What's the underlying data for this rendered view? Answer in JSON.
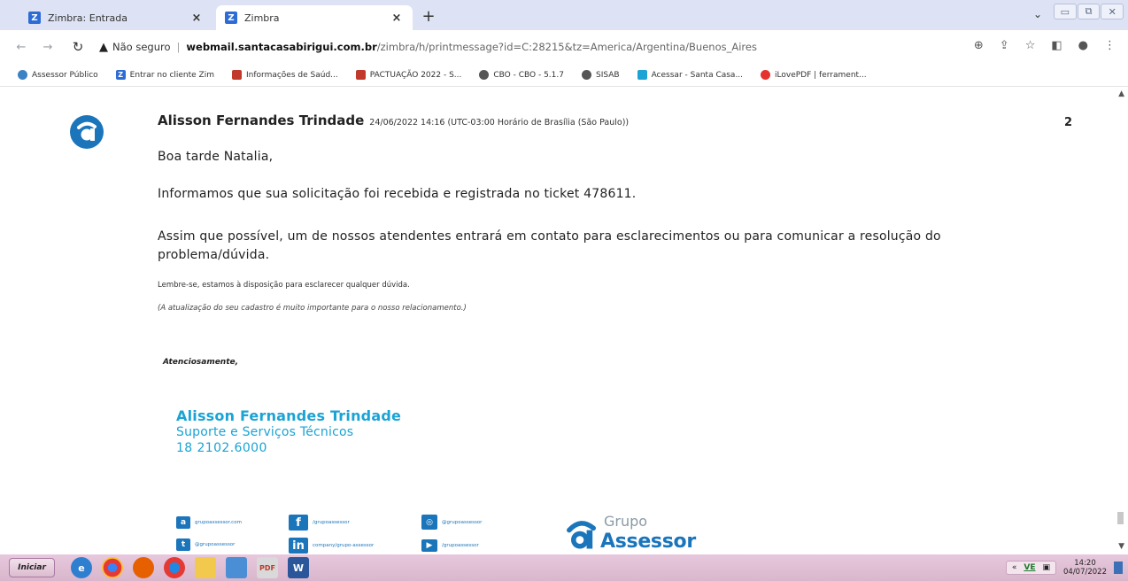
{
  "browser": {
    "tabs": [
      {
        "title": "Zimbra: Entrada",
        "favicon": "Z",
        "active": false
      },
      {
        "title": "Zimbra",
        "favicon": "Z",
        "active": true
      }
    ],
    "tab_close_glyph": "×",
    "new_tab_glyph": "+",
    "address": {
      "security_label": "Não seguro",
      "host": "webmail.santacasabirigui.com.br",
      "path": "/zimbra/h/printmessage?id=C:28215&tz=America/Argentina/Buenos_Aires"
    }
  },
  "bookmarks": [
    {
      "label": "Assessor Público",
      "icon_color": "#3b82c4"
    },
    {
      "label": "Entrar no cliente Zim",
      "icon_color": "#2d6bd5",
      "glyph": "Z"
    },
    {
      "label": "Informações de Saúd...",
      "icon_color": "#c0392b"
    },
    {
      "label": "PACTUAÇÃO 2022 - S...",
      "icon_color": "#c0392b"
    },
    {
      "label": "CBO - CBO - 5.1.7",
      "icon_color": "#555555"
    },
    {
      "label": "SISAB",
      "icon_color": "#555555"
    },
    {
      "label": "Acessar - Santa Casa...",
      "icon_color": "#1aa3d4"
    },
    {
      "label": "iLovePDF | ferrament...",
      "icon_color": "#e5322d"
    }
  ],
  "email": {
    "sender_name": "Alisson Fernandes Trindade",
    "sent_date": "24/06/2022 14:16 (UTC-03:00 Horário de Brasília (São Paulo))",
    "page_number": "2",
    "greeting": "Boa tarde Natalia,",
    "paragraph_1": "Informamos que sua solicitação foi recebida e registrada no ticket 478611.",
    "paragraph_2_line_1": "Assim que possível, um de nossos atendentes entrará em contato para esclarecimentos ou para comunicar a resolução do",
    "paragraph_2_line_2": "problema/dúvida.",
    "reminder": "Lembre-se, estamos à disposição para esclarecer qualquer dúvida.",
    "update_note": "(A atualização do seu cadastro é muito importante para o nosso relacionamento.)",
    "closing": "Atenciosamente,"
  },
  "signature": {
    "name": "Alisson Fernandes Trindade",
    "role": "Suporte e Serviços Técnicos",
    "phone": "18 2102.6000",
    "brand_small": "Grupo",
    "brand_large": "Assessor",
    "brand_color": "#1b75bb",
    "accent_color": "#1aa3d4",
    "social": [
      {
        "icon": "assessor-icon",
        "glyph": "a",
        "text": "grupoassessor.com"
      },
      {
        "icon": "facebook-icon",
        "glyph": "f",
        "text": "/grupoassessor"
      },
      {
        "icon": "instagram-icon",
        "glyph": "◎",
        "text": "@grupoassessor"
      },
      {
        "icon": "twitter-icon",
        "glyph": "t",
        "text": "@grupoassessor"
      },
      {
        "icon": "linkedin-icon",
        "glyph": "in",
        "text": "company/grupo-assessor"
      },
      {
        "icon": "youtube-icon",
        "glyph": "▶",
        "text": "/grupoassessor"
      }
    ]
  },
  "taskbar": {
    "start_label": "Iniciar",
    "tray_lang": "VE",
    "time": "14:20",
    "date": "04/07/2022"
  }
}
